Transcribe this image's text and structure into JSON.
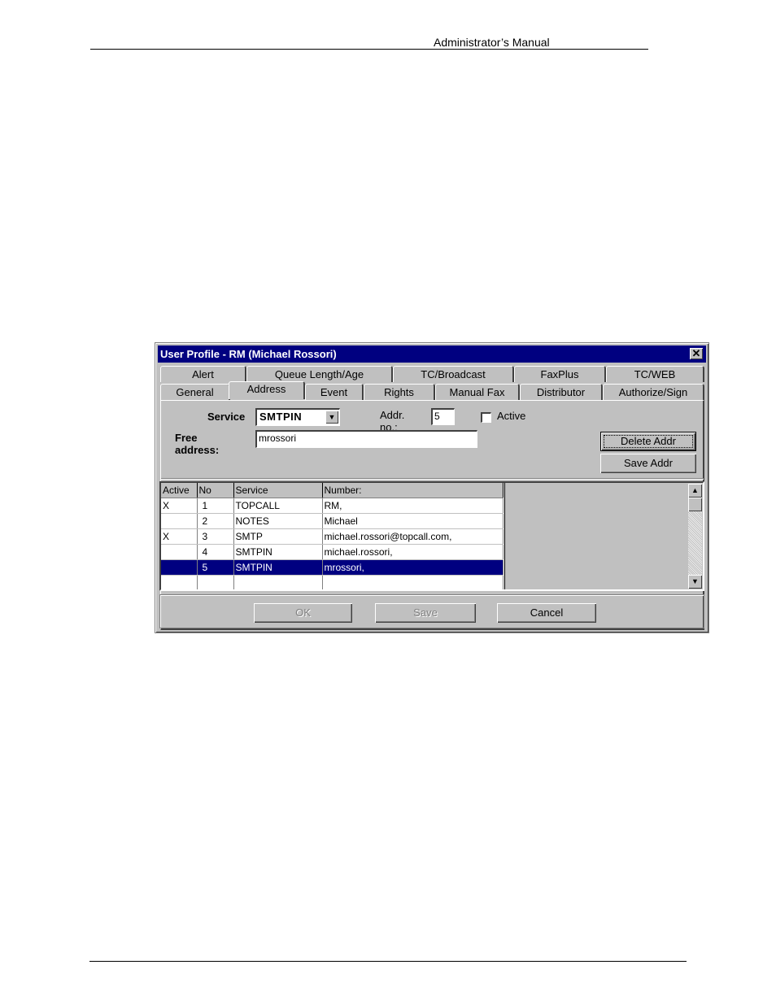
{
  "document": {
    "header": "Administrator’s Manual"
  },
  "dialog": {
    "title": "User Profile - RM (Michael Rossori)",
    "close_glyph": "✕",
    "tabs_back_row": [
      "Alert",
      "Queue Length/Age",
      "TC/Broadcast",
      "FaxPlus",
      "TC/WEB"
    ],
    "tabs_front_row": [
      "General",
      "Address",
      "Event",
      "Rights",
      "Manual Fax",
      "Distributor",
      "Authorize/Sign"
    ],
    "active_tab": "Address",
    "form": {
      "service_label": "Service",
      "service_value": "SMTPIN",
      "addr_no_label": "Addr. no.:",
      "addr_no_value": "5",
      "active_label": "Active",
      "active_checked": false,
      "free_address_label": "Free address:",
      "free_address_value": "mrossori",
      "delete_addr_button": "Delete Addr",
      "save_addr_button": "Save Addr"
    },
    "table": {
      "columns": [
        "Active",
        "No",
        "Service",
        "Number:"
      ],
      "rows": [
        {
          "active": "X",
          "no": "1",
          "service": "TOPCALL",
          "number": "RM,"
        },
        {
          "active": "",
          "no": "2",
          "service": "NOTES",
          "number": "Michael"
        },
        {
          "active": "X",
          "no": "3",
          "service": "SMTP",
          "number": "michael.rossori@topcall.com,"
        },
        {
          "active": "",
          "no": "4",
          "service": "SMTPIN",
          "number": "michael.rossori,"
        },
        {
          "active": "",
          "no": "5",
          "service": "SMTPIN",
          "number": "mrossori,"
        },
        {
          "active": "",
          "no": "",
          "service": "",
          "number": ""
        }
      ],
      "selected_row": 5
    },
    "icons": {
      "dropdown": "▼",
      "scroll_up": "▲",
      "scroll_down": "▼"
    },
    "buttons": {
      "ok": "OK",
      "save": "Save",
      "cancel": "Cancel"
    },
    "colors": {
      "titlebar": "#000080",
      "face": "#c0c0c0",
      "selection": "#000080"
    }
  }
}
